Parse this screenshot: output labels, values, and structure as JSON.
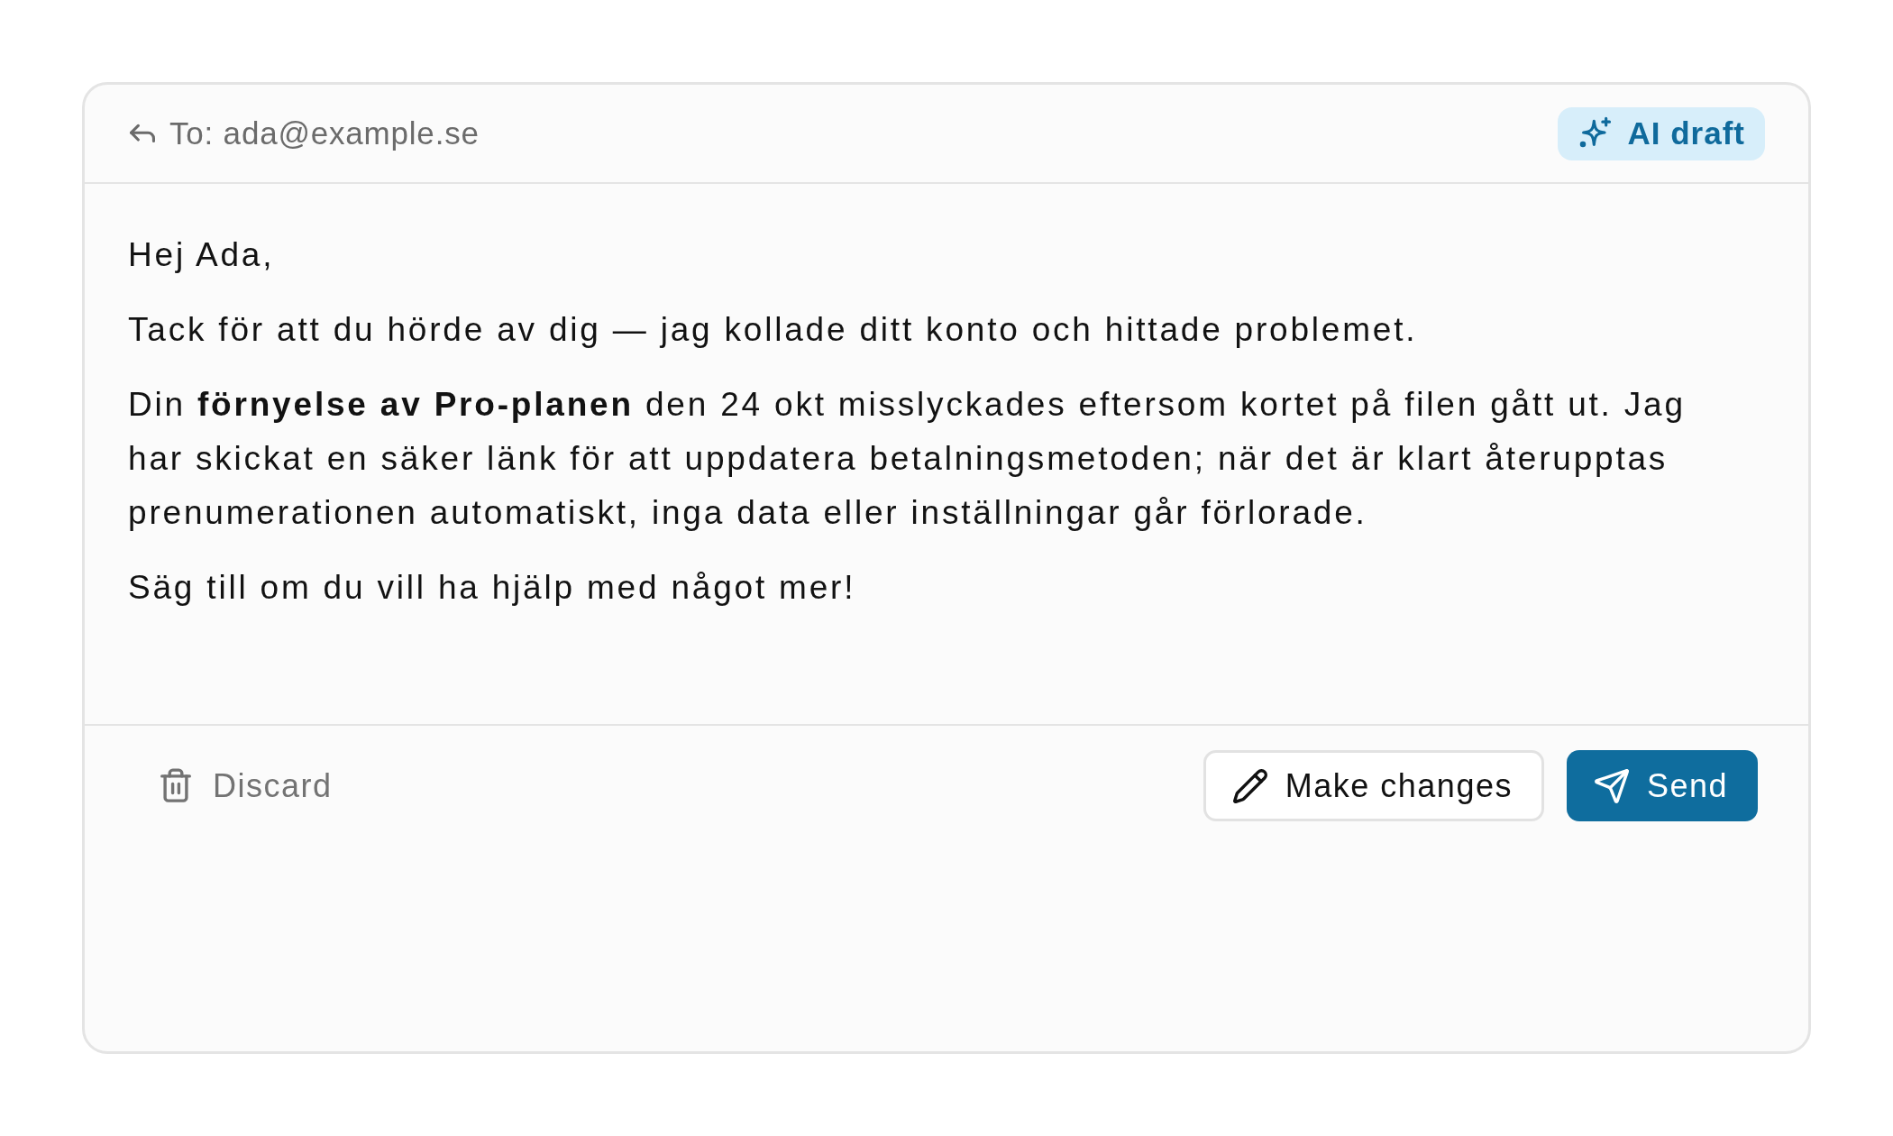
{
  "email": {
    "recipient": "To: ada@example.se",
    "badge": "AI draft",
    "body": [
      "Hej Ada,",
      "Tack för att du hörde av dig — jag kollade ditt konto och hittade problemet.",
      "Din **förnyelse av Pro-planen** den 24 okt misslyckades eftersom kortet på filen gått ut. Jag har skickat en säker länk för att uppdatera betalningsmetoden; när det är klart återupptas prenumerationen automatiskt, inga data eller inställningar går förlorade.",
      "Säg till om du vill ha hjälp med något mer!"
    ]
  },
  "actions": [
    {
      "label": "Discard",
      "kind": "discard"
    },
    {
      "label": "Make changes",
      "kind": "edit"
    },
    {
      "label": "Send",
      "kind": "send"
    }
  ]
}
